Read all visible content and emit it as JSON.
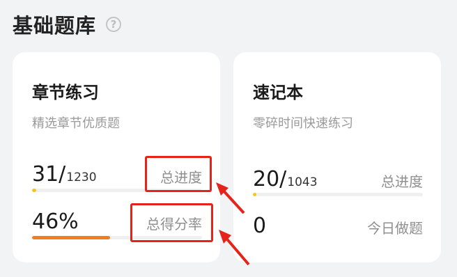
{
  "header": {
    "title": "基础题库",
    "help_icon": "?"
  },
  "cards": [
    {
      "title": "章节练习",
      "subtitle": "精选章节优质题",
      "stats": [
        {
          "value": "31/",
          "total": "1230",
          "label": "总进度",
          "progress": 0.025,
          "bar_color": "#f5c518"
        },
        {
          "value": "46%",
          "label": "总得分率",
          "progress": 0.46,
          "bar_color": "#ef7d22"
        }
      ]
    },
    {
      "title": "速记本",
      "subtitle": "零碎时间快速练习",
      "stats": [
        {
          "value": "20/",
          "total": "1043",
          "label": "总进度",
          "progress": 0.019,
          "bar_color": "#f5c518"
        },
        {
          "value": "0",
          "label": "今日做题"
        }
      ]
    }
  ],
  "colors": {
    "accent_yellow": "#f5c518",
    "accent_orange": "#ef7d22",
    "annotation_red": "#e5231b"
  }
}
